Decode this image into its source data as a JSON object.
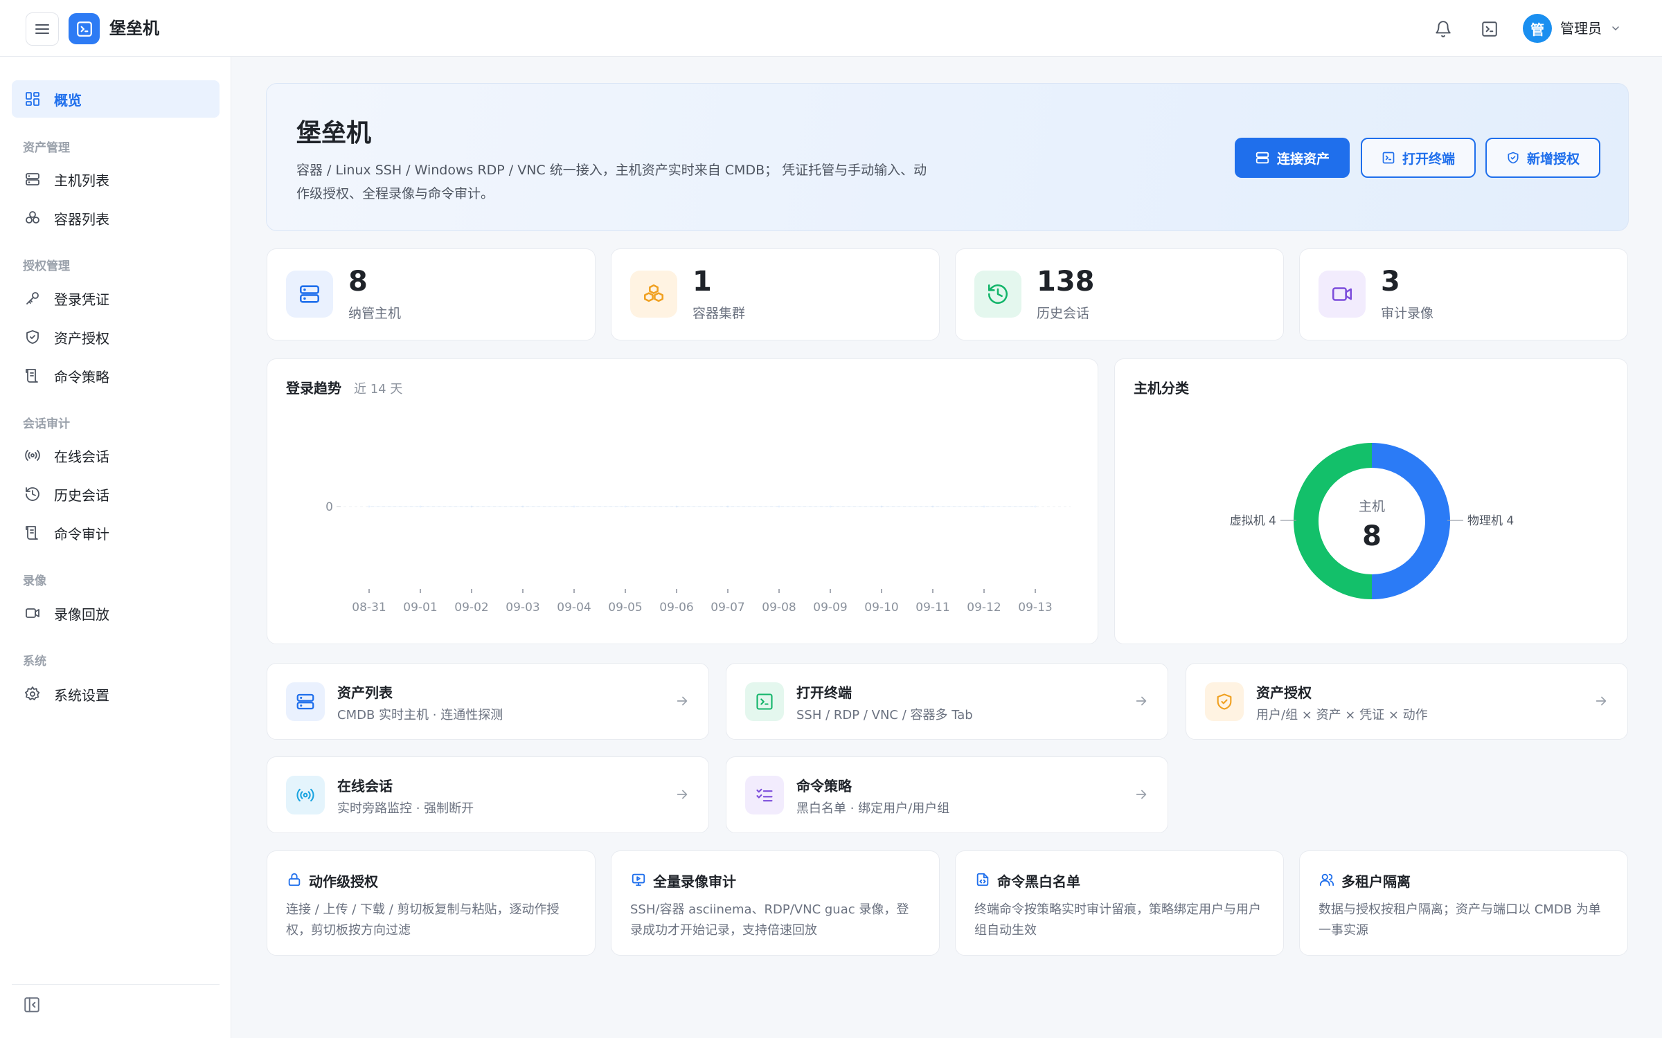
{
  "header": {
    "title": "堡垒机",
    "avatar_char": "管",
    "user_name": "管理员"
  },
  "sidebar": {
    "overview": "概览",
    "groups": {
      "asset": "资产管理",
      "auth": "授权管理",
      "session": "会话审计",
      "record": "录像",
      "system": "系统"
    },
    "items": {
      "host_list": "主机列表",
      "container_list": "容器列表",
      "credential": "登录凭证",
      "asset_auth": "资产授权",
      "cmd_policy": "命令策略",
      "online_session": "在线会话",
      "history_session": "历史会话",
      "cmd_audit": "命令审计",
      "replay": "录像回放",
      "settings": "系统设置"
    }
  },
  "hero": {
    "title": "堡垒机",
    "description": "容器 / Linux SSH / Windows RDP / VNC 统一接入，主机资产实时来自 CMDB； 凭证托管与手动输入、动作级授权、全程录像与命令审计。",
    "buttons": {
      "connect": "连接资产",
      "terminal": "打开终端",
      "add_auth": "新增授权"
    }
  },
  "stats": [
    {
      "value": "8",
      "label": "纳管主机"
    },
    {
      "value": "1",
      "label": "容器集群"
    },
    {
      "value": "138",
      "label": "历史会话"
    },
    {
      "value": "3",
      "label": "审计录像"
    }
  ],
  "trend": {
    "title": "登录趋势",
    "subtitle": "近 14 天"
  },
  "donut": {
    "title": "主机分类",
    "center_label": "主机",
    "center_value": "8",
    "label_left": "虚拟机 4",
    "label_right": "物理机 4"
  },
  "chart_data": [
    {
      "type": "line",
      "title": "登录趋势",
      "subtitle": "近 14 天",
      "x": [
        "08-31",
        "09-01",
        "09-02",
        "09-03",
        "09-04",
        "09-05",
        "09-06",
        "09-07",
        "09-08",
        "09-09",
        "09-10",
        "09-11",
        "09-12",
        "09-13"
      ],
      "series": [
        {
          "values": [
            0,
            0,
            0,
            0,
            0,
            0,
            0,
            0,
            0,
            0,
            0,
            0,
            0,
            0
          ]
        }
      ],
      "yticks": [
        "0"
      ],
      "grid": true
    },
    {
      "type": "pie",
      "title": "主机分类",
      "categories": [
        "物理机",
        "虚拟机"
      ],
      "values": [
        4,
        4
      ],
      "colors": [
        "#2b7bf6",
        "#13c06a"
      ],
      "center_label": "主机",
      "center_value": 8
    }
  ],
  "quick_links": [
    {
      "title": "资产列表",
      "sub": "CMDB 实时主机 · 连通性探测"
    },
    {
      "title": "打开终端",
      "sub": "SSH / RDP / VNC / 容器多 Tab"
    },
    {
      "title": "资产授权",
      "sub": "用户/组 × 资产 × 凭证 × 动作"
    },
    {
      "title": "在线会话",
      "sub": "实时旁路监控 · 强制断开"
    },
    {
      "title": "命令策略",
      "sub": "黑白名单 · 绑定用户/用户组"
    }
  ],
  "features": [
    {
      "title": "动作级授权",
      "desc": "连接 / 上传 / 下载 / 剪切板复制与粘贴，逐动作授权，剪切板按方向过滤"
    },
    {
      "title": "全量录像审计",
      "desc": "SSH/容器 asciinema、RDP/VNC guac 录像，登录成功才开始记录，支持倍速回放"
    },
    {
      "title": "命令黑白名单",
      "desc": "终端命令按策略实时审计留痕，策略绑定用户与用户组自动生效"
    },
    {
      "title": "多租户隔离",
      "desc": "数据与授权按租户隔离；资产与端口以 CMDB 为单一事实源"
    }
  ],
  "colors": {
    "primary": "#1f6fec",
    "blue_tint": "#eaf1fe",
    "orange": "#f0a020",
    "orange_tint": "#fff3e2",
    "green": "#13b56a",
    "green_tint": "#e4f7ee",
    "purple": "#7c4ddb",
    "purple_tint": "#f2ecfd",
    "cyan": "#1aa4e0",
    "cyan_tint": "#e4f4fc"
  }
}
